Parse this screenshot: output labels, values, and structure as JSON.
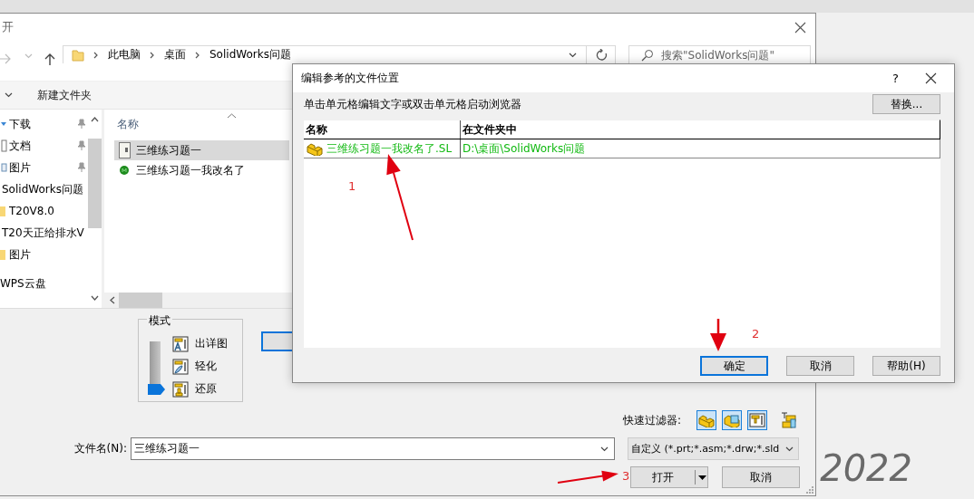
{
  "open_dialog": {
    "title": "开",
    "path": [
      "此电脑",
      "桌面",
      "SolidWorks问题"
    ],
    "search": {
      "placeholder": "搜索\"SolidWorks问题\""
    },
    "toolbar": [
      "新建文件夹"
    ],
    "nav_items": [
      {
        "label": "下载",
        "kind": "download",
        "pinned": true
      },
      {
        "label": "文档",
        "kind": "document",
        "pinned": true
      },
      {
        "label": "图片",
        "kind": "pictures",
        "pinned": true
      },
      {
        "label": "SolidWorks问题",
        "kind": "folder",
        "pinned": false
      },
      {
        "label": "T20V8.0",
        "kind": "folder",
        "pinned": false
      },
      {
        "label": "T20天正给排水V",
        "kind": "folder",
        "pinned": false
      },
      {
        "label": "图片",
        "kind": "folder",
        "pinned": false
      },
      {
        "label": "WPS云盘",
        "kind": "cloud",
        "pinned": false
      }
    ],
    "file_list": {
      "column": "名称",
      "files": [
        {
          "name": "三维练习题一",
          "kind": "drawing",
          "selected": true
        },
        {
          "name": "三维练习题一我改名了",
          "kind": "part",
          "selected": false
        }
      ]
    },
    "mode": {
      "title": "模式",
      "options": [
        {
          "label": "出详图",
          "kind": "detail",
          "selected": false
        },
        {
          "label": "轻化",
          "kind": "lightweight",
          "selected": false
        },
        {
          "label": "还原",
          "kind": "resolved",
          "selected": true
        }
      ]
    },
    "quick_filter": {
      "label": "快速过滤器:",
      "filters": [
        {
          "kind": "part",
          "on": true
        },
        {
          "kind": "assembly",
          "on": true
        },
        {
          "kind": "drawing",
          "on": true
        },
        {
          "kind": "top-level",
          "on": false
        }
      ]
    },
    "filename": {
      "label": "文件名(N):",
      "value": "三维练习题一"
    },
    "filetype": "自定义 (*.prt;*.asm;*.drw;*.sld",
    "buttons": [
      "打开",
      "取消"
    ]
  },
  "ref_dialog": {
    "title": "编辑参考的文件位置",
    "help": "?",
    "instruction": "单击单元格编辑文字或双击单元格启动浏览器",
    "replace_button": "替换...",
    "table": {
      "columns": [
        "名称",
        "在文件夹中"
      ],
      "rows": [
        {
          "name": "三维练习题一我改名了.SL",
          "folder": "D:\\桌面\\SolidWorks问题"
        }
      ]
    },
    "buttons": [
      {
        "label": "确定",
        "selected": true
      },
      {
        "label": "取消",
        "selected": false
      },
      {
        "label": "帮助(H)",
        "selected": false
      }
    ]
  },
  "annotations": [
    {
      "label": "1"
    },
    {
      "label": "2"
    },
    {
      "label": "3"
    }
  ],
  "background_text": "2022"
}
